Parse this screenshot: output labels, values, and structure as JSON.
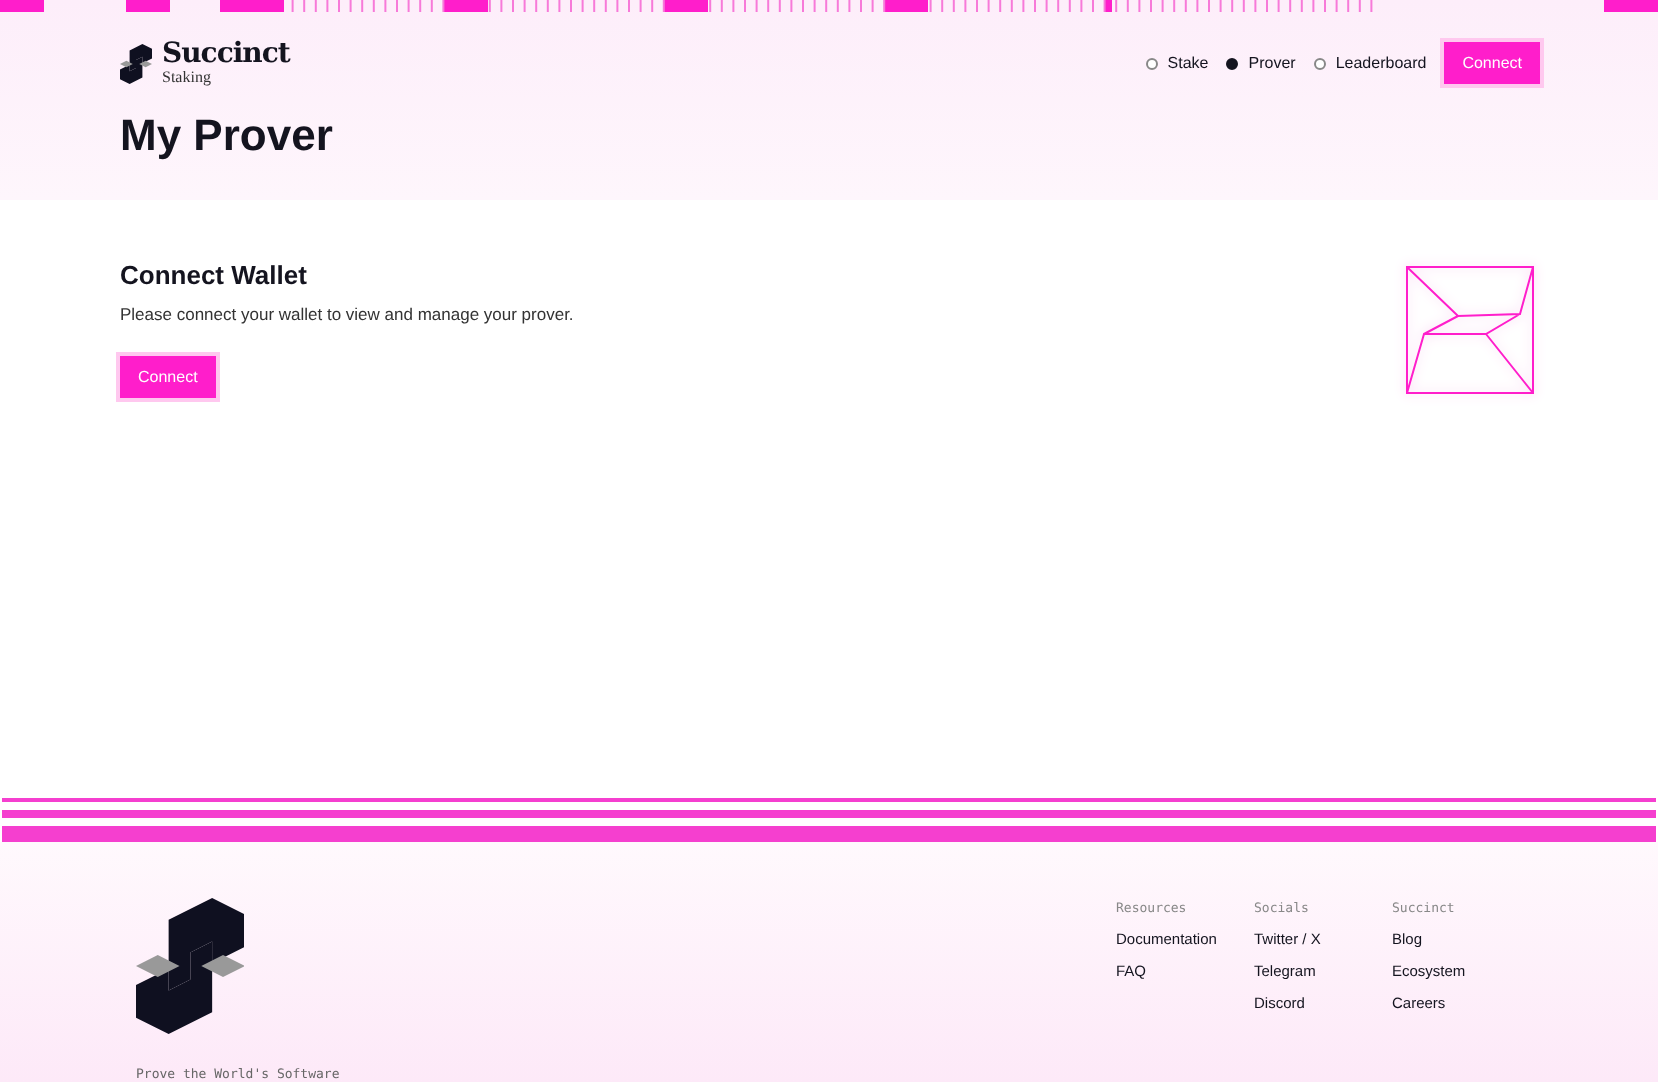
{
  "brand": {
    "name": "Succinct",
    "subtitle": "Staking"
  },
  "nav": [
    {
      "label": "Stake",
      "selected": false
    },
    {
      "label": "Prover",
      "selected": true
    },
    {
      "label": "Leaderboard",
      "selected": false
    }
  ],
  "header_button": "Connect",
  "page_title": "My Prover",
  "wallet": {
    "title": "Connect Wallet",
    "message": "Please connect your wallet to view and manage your prover.",
    "button": "Connect"
  },
  "footer": {
    "tagline": "Prove the World's Software",
    "columns": [
      {
        "heading": "Resources",
        "links": [
          "Documentation",
          "FAQ"
        ]
      },
      {
        "heading": "Socials",
        "links": [
          "Twitter / X",
          "Telegram",
          "Discord"
        ]
      },
      {
        "heading": "Succinct",
        "links": [
          "Blog",
          "Ecosystem",
          "Careers"
        ]
      }
    ]
  }
}
